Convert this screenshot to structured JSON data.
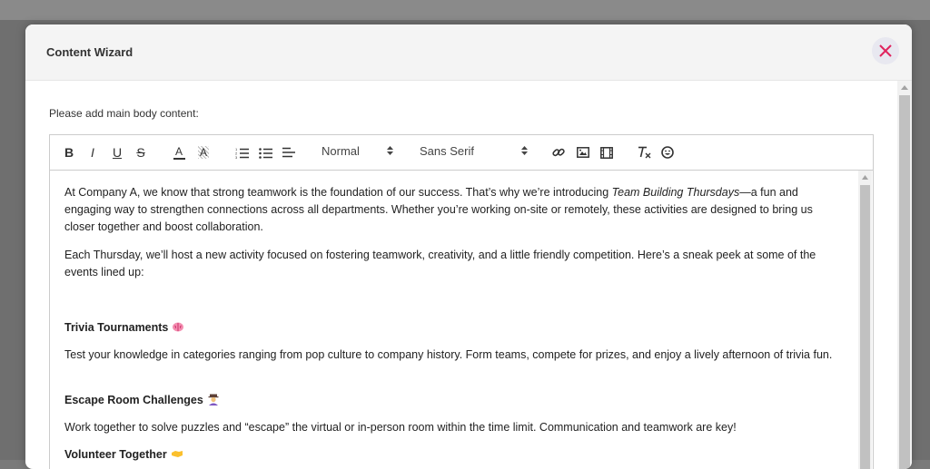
{
  "modal": {
    "title": "Content Wizard",
    "close_icon": "close-icon",
    "accent_color": "#e0245e"
  },
  "form": {
    "prompt_label": "Please add main body content:"
  },
  "toolbar": {
    "bold": "B",
    "italic": "I",
    "underline": "U",
    "strike": "S",
    "font_color": "A",
    "background_color": "A",
    "header_select": "Normal",
    "font_select": "Sans Serif"
  },
  "content": {
    "p1_a": "At Company A, we know that strong teamwork is the foundation of our success. That’s why we’re introducing ",
    "p1_em": "Team Building Thursdays",
    "p1_b": "—a fun and engaging way to strengthen connections across all departments. Whether you’re working on-site or remotely, these activities are designed to bring us closer together and boost collaboration.",
    "p2": "Each Thursday, we’ll host a new activity focused on fostering teamwork, creativity, and a little friendly competition. Here’s a sneak peek at some of the events lined up:",
    "h1": "Trivia Tournaments",
    "p3": "Test your knowledge in categories ranging from pop culture to company history. Form teams, compete for prizes, and enjoy a lively afternoon of trivia fun.",
    "h2": "Escape Room Challenges",
    "p4": "Work together to solve puzzles and “escape” the virtual or in-person room within the time limit. Communication and teamwork are key!",
    "h3": "Volunteer Together"
  }
}
